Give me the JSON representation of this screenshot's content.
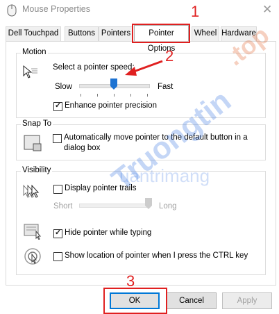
{
  "window": {
    "title": "Mouse Properties"
  },
  "tabs": [
    {
      "label": "Dell Touchpad"
    },
    {
      "label": "Buttons"
    },
    {
      "label": "Pointers"
    },
    {
      "label": "Pointer Options"
    },
    {
      "label": "Wheel"
    },
    {
      "label": "Hardware"
    }
  ],
  "motion": {
    "group_label": "Motion",
    "speed_label": "Select a pointer speed:",
    "slow_label": "Slow",
    "fast_label": "Fast",
    "speed_level": 0.5,
    "enhance_label": "Enhance pointer precision",
    "enhance_checked": true
  },
  "snap_to": {
    "group_label": "Snap To",
    "line1": "Automatically move pointer to the default button in a",
    "line2": "dialog box",
    "checked": false
  },
  "visibility": {
    "group_label": "Visibility",
    "trails_label": "Display pointer trails",
    "trails_checked": false,
    "short_label": "Short",
    "long_label": "Long",
    "trails_level": 1.0,
    "hide_label": "Hide pointer while typing",
    "hide_checked": true,
    "ctrl_label": "Show location of pointer when I press the CTRL key",
    "ctrl_checked": false
  },
  "buttons": {
    "ok": "OK",
    "cancel": "Cancel",
    "apply": "Apply"
  },
  "annotations": {
    "n1": "1",
    "n2": "2",
    "n3": "3"
  },
  "watermarks": {
    "site": "Truongtin",
    "tld": ".top",
    "brand": "uantrimang"
  },
  "colors": {
    "annotation_red": "#e02020",
    "focus_blue": "#0078d7",
    "thumb_blue": "#1e73d2"
  }
}
